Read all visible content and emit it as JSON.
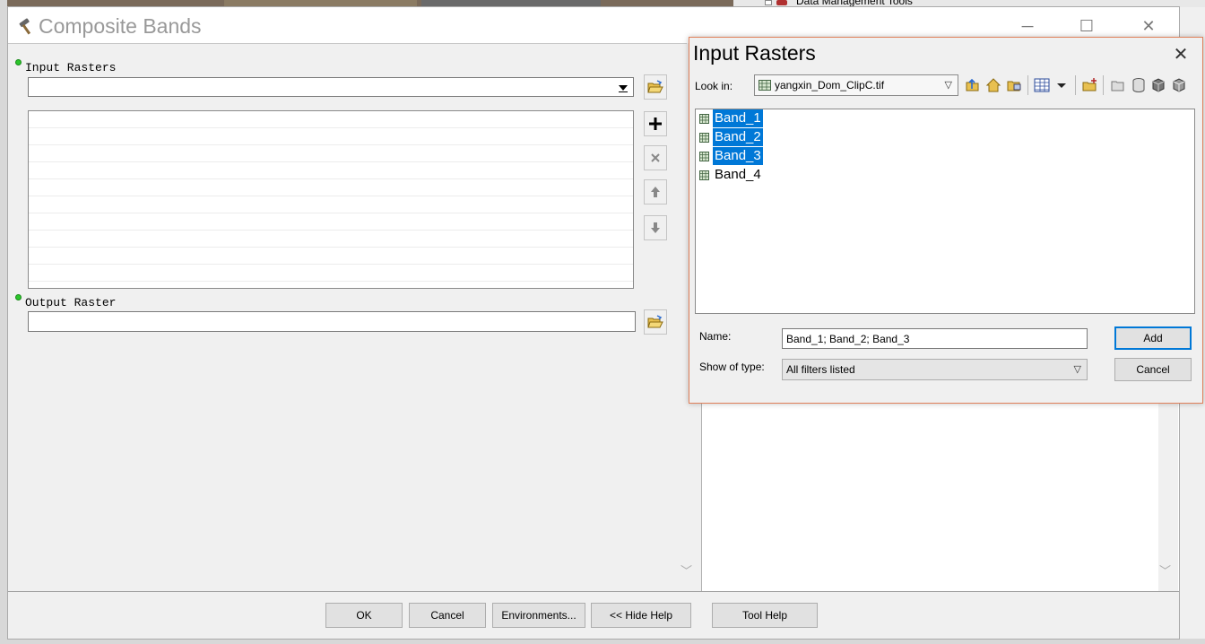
{
  "background": {
    "tree_item_label": "Data Management Tools"
  },
  "window": {
    "title": "Composite Bands",
    "minimize": "─",
    "maximize": "☐",
    "close": "✕"
  },
  "form": {
    "input_rasters_label": "Input Rasters",
    "input_rasters_value": "",
    "output_raster_label": "Output Raster",
    "output_raster_value": "",
    "list_rows": [
      "",
      "",
      "",
      "",
      "",
      "",
      "",
      "",
      "",
      ""
    ]
  },
  "buttons": {
    "ok": "OK",
    "cancel": "Cancel",
    "environments": "Environments...",
    "hide_help": "<< Hide Help",
    "tool_help": "Tool Help"
  },
  "dialog": {
    "title": "Input Rasters",
    "close": "✕",
    "look_in_label": "Look in:",
    "look_in_value": "yangxin_Dom_ClipC.tif",
    "items": [
      {
        "name": "Band_1",
        "selected": true
      },
      {
        "name": "Band_2",
        "selected": true
      },
      {
        "name": "Band_3",
        "selected": true
      },
      {
        "name": "Band_4",
        "selected": false
      }
    ],
    "name_label": "Name:",
    "name_value": "Band_1; Band_2; Band_3",
    "type_label": "Show of type:",
    "type_value": "All filters listed",
    "add_button": "Add",
    "cancel_button": "Cancel"
  },
  "colors": {
    "selection": "#0078d7",
    "dialog_border": "#e0805a",
    "required_dot": "#2bc62b"
  },
  "icons": {
    "title_icon": "hammer-icon",
    "browse": "open-folder-icon",
    "add": "plus-icon",
    "remove": "x-icon",
    "up": "arrow-up-icon",
    "down": "arrow-down-icon",
    "raster": "raster-grid-icon"
  }
}
